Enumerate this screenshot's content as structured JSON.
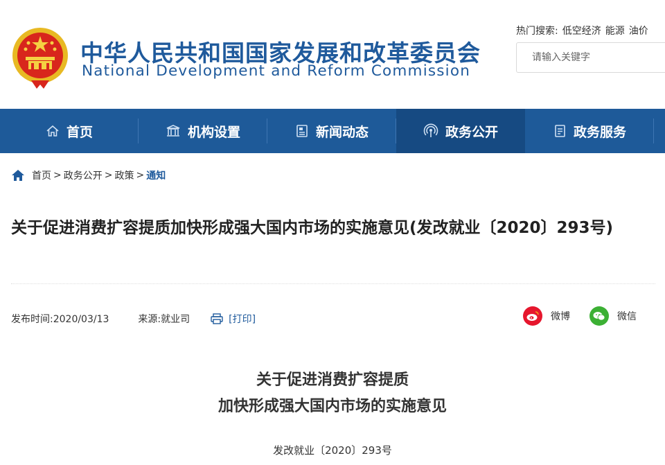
{
  "header": {
    "title_cn": "中华人民共和国国家发展和改革委员会",
    "title_en": "National Development and Reform Commission",
    "hot_search_label": "热门搜索:",
    "hot_terms": [
      "低空经济",
      "能源",
      "油价"
    ],
    "search_placeholder": "请输入关键字"
  },
  "nav": {
    "items": [
      {
        "label": "首页",
        "icon": "home-icon"
      },
      {
        "label": "机构设置",
        "icon": "building-icon"
      },
      {
        "label": "新闻动态",
        "icon": "news-icon"
      },
      {
        "label": "政务公开",
        "icon": "broadcast-icon",
        "active": true
      },
      {
        "label": "政务服务",
        "icon": "document-icon"
      }
    ]
  },
  "breadcrumb": {
    "items": [
      "首页",
      "政务公开",
      "政策",
      "通知"
    ],
    "separator": ">"
  },
  "article": {
    "title": "关于促进消费扩容提质加快形成强大国内市场的实施意见(发改就业〔2020〕293号)",
    "publish_time": "发布时间:2020/03/13",
    "source": "来源:就业司",
    "print_label": "[打印]",
    "share_weibo": "微博",
    "share_weixin": "微信",
    "heading_line1": "关于促进消费扩容提质",
    "heading_line2": "加快形成强大国内市场的实施意见",
    "doc_number": "发改就业〔2020〕293号"
  },
  "colors": {
    "brand_blue": "#1f5a9c",
    "nav_bg": "#1e5a99",
    "nav_active": "#164a82",
    "weibo_red": "#e6162d",
    "weixin_green": "#3cb034"
  }
}
